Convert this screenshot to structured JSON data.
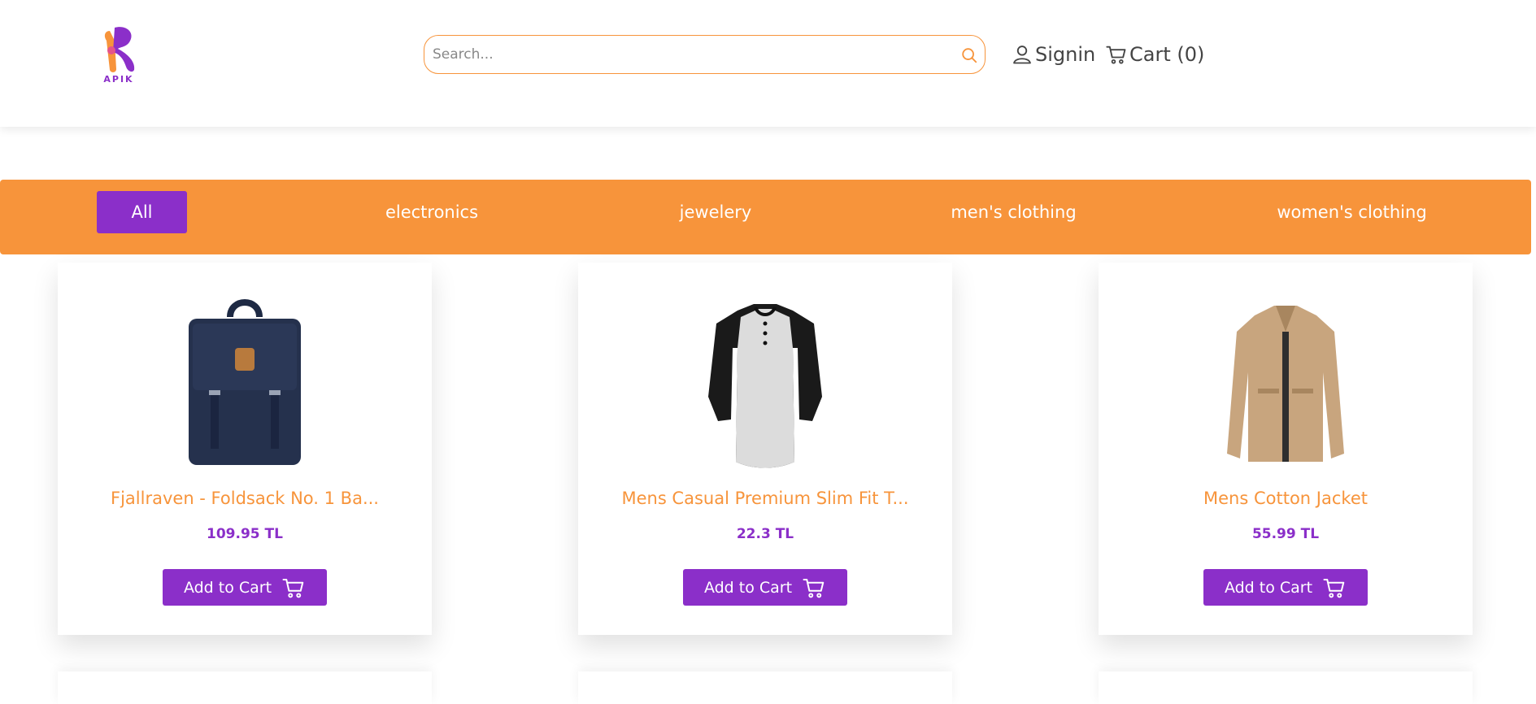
{
  "brand": {
    "logo_text": "APIK",
    "primary_color": "#8b2fc9",
    "accent_color": "#f7943b"
  },
  "search": {
    "placeholder": "Search...",
    "icon": "search-icon"
  },
  "nav": {
    "signin_label": "Signin",
    "cart_label": "Cart (0)"
  },
  "categories": [
    {
      "label": "All",
      "active": true
    },
    {
      "label": "electronics",
      "active": false
    },
    {
      "label": "jewelery",
      "active": false
    },
    {
      "label": "men's clothing",
      "active": false
    },
    {
      "label": "women's clothing",
      "active": false
    }
  ],
  "products": [
    {
      "title": "Fjallraven - Foldsack No. 1 Ba...",
      "price": "109.95 TL",
      "button": "Add to Cart",
      "image": "backpack"
    },
    {
      "title": "Mens Casual Premium Slim Fit T...",
      "price": "22.3 TL",
      "button": "Add to Cart",
      "image": "henley-shirt"
    },
    {
      "title": "Mens Cotton Jacket",
      "price": "55.99 TL",
      "button": "Add to Cart",
      "image": "cotton-jacket"
    }
  ]
}
